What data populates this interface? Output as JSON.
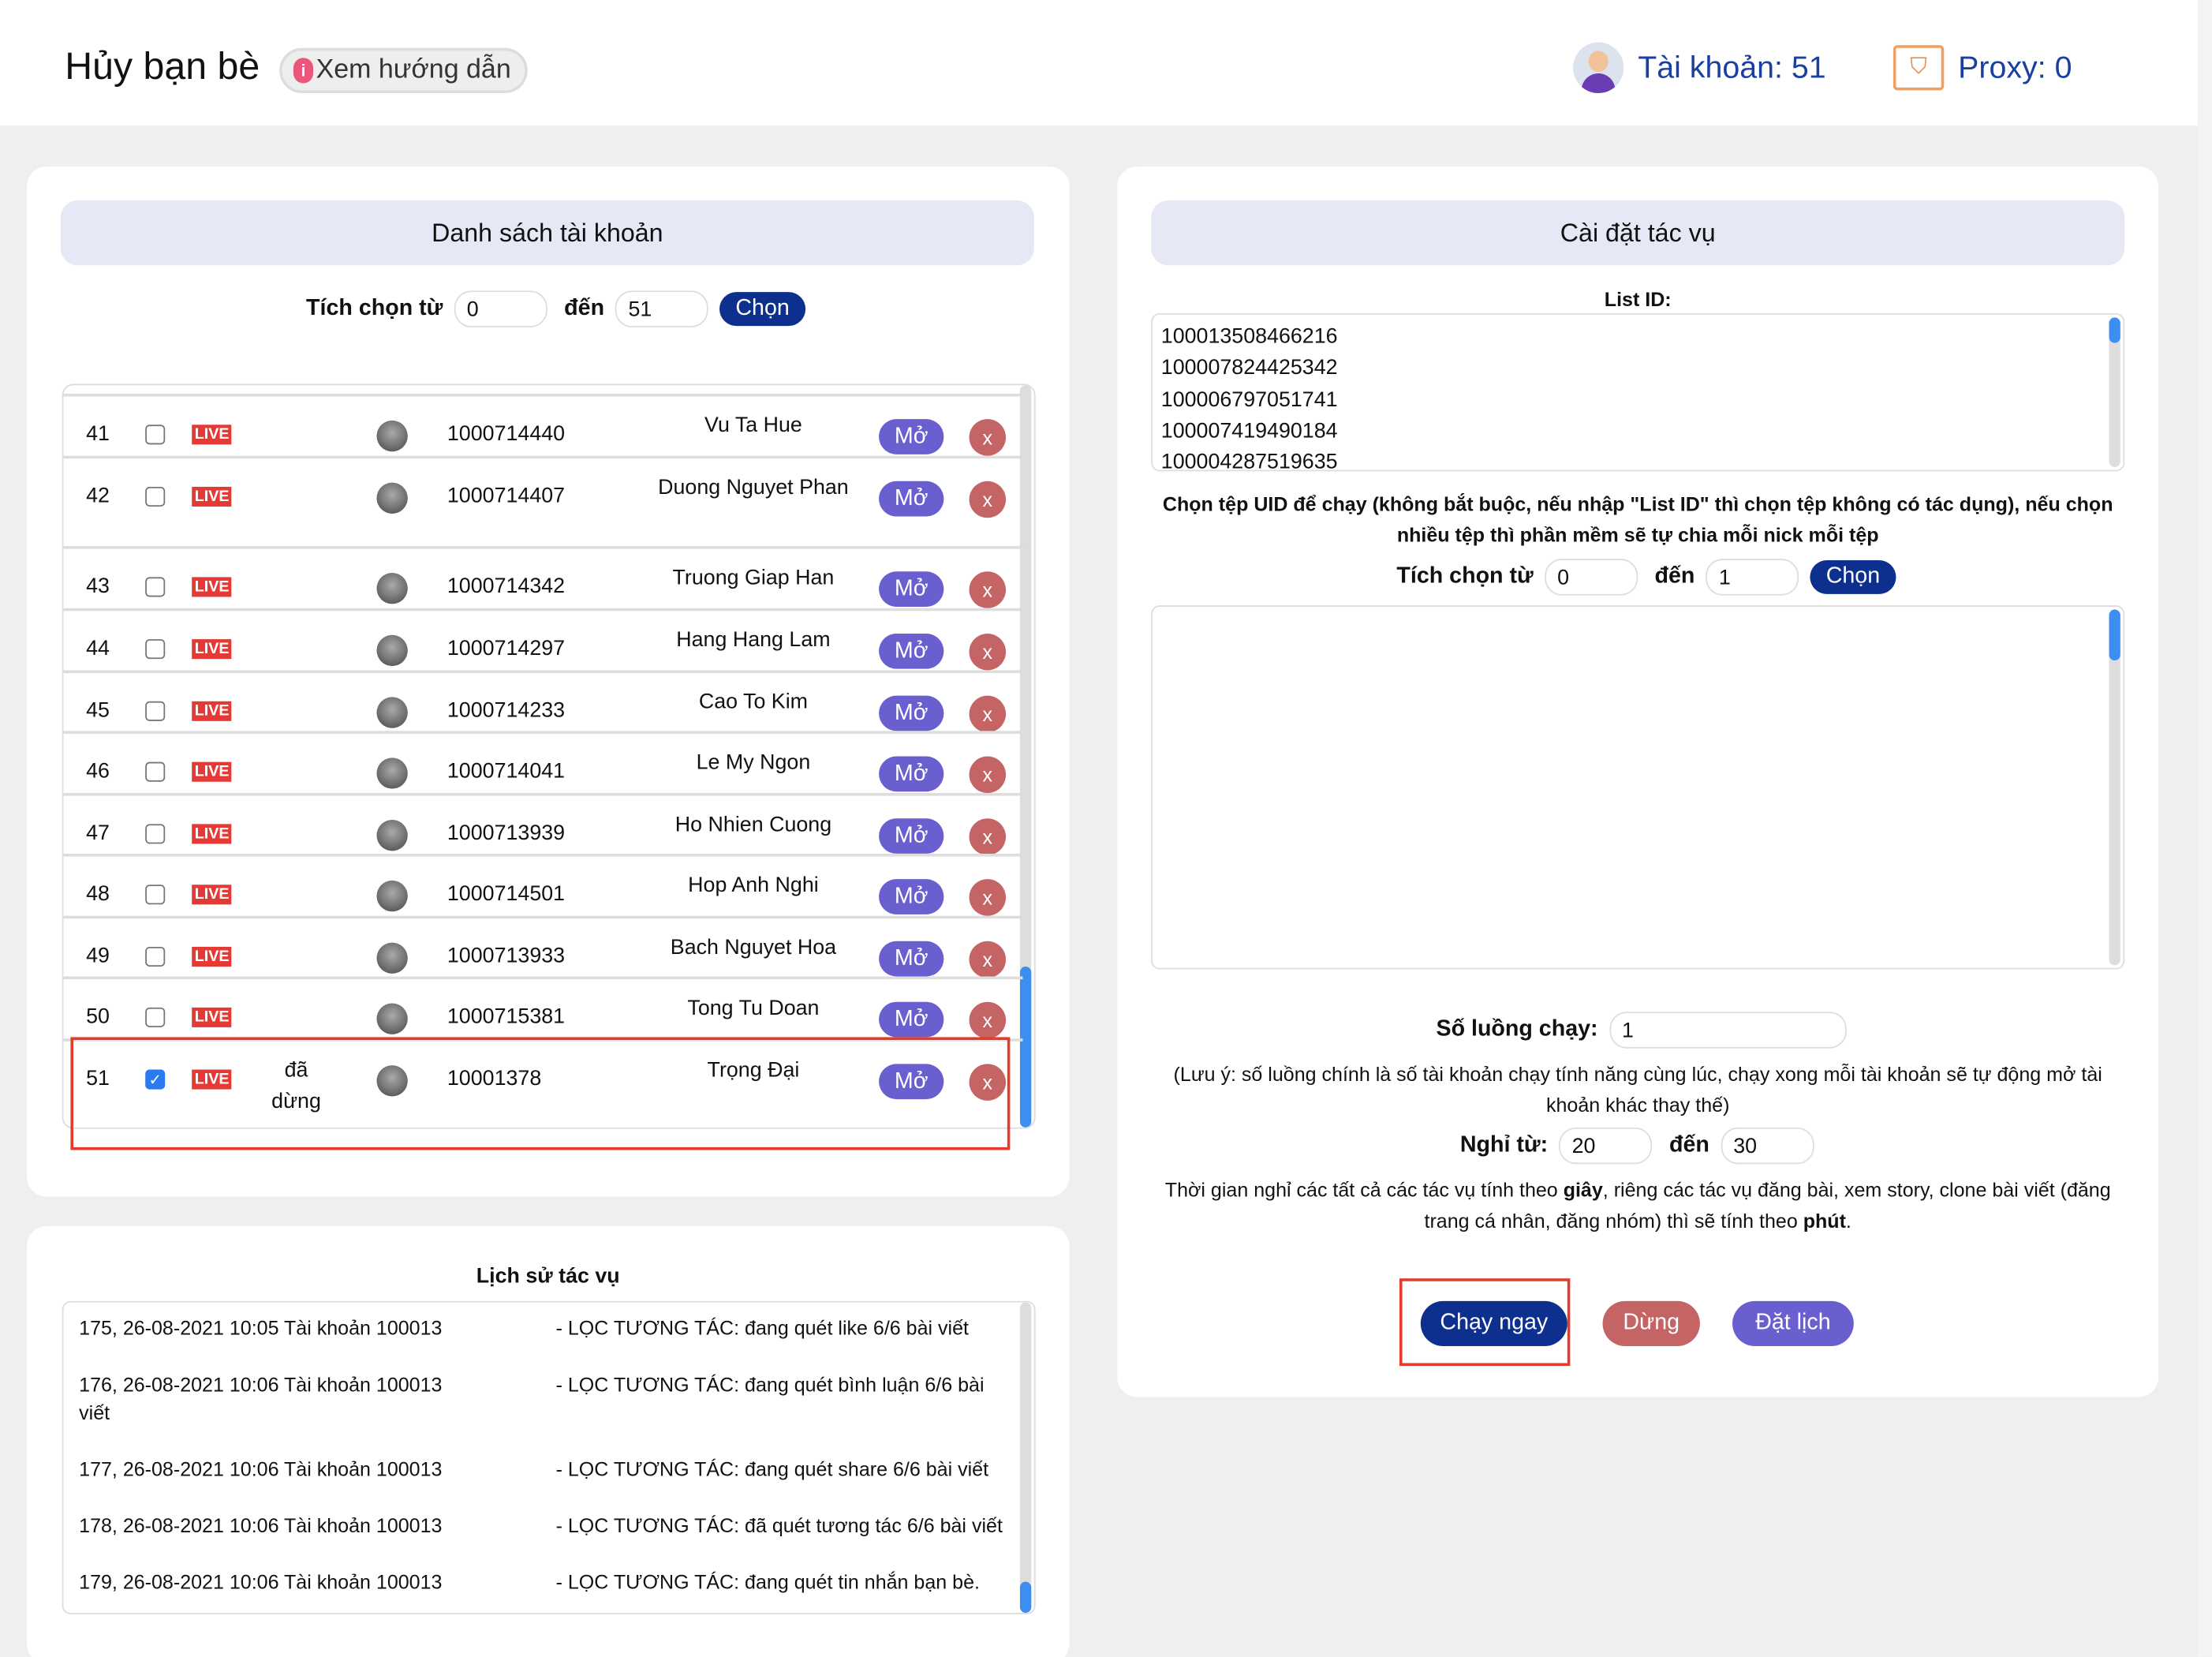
{
  "header": {
    "title": "Hủy bạn bè",
    "guide_label": "Xem hướng dẫn",
    "account_label": "Tài khoản: 51",
    "proxy_label": "Proxy: 0"
  },
  "accounts_panel": {
    "title": "Danh sách tài khoản",
    "range_label": "Tích chọn từ",
    "range_from": "0",
    "range_to_label": "đến",
    "range_to": "51",
    "choose_label": "Chọn",
    "rows": [
      {
        "no": "41",
        "checked": false,
        "status": "LIVE",
        "state": "",
        "uid": "1000714440",
        "name": "Vu Ta Hue"
      },
      {
        "no": "42",
        "checked": false,
        "status": "LIVE",
        "state": "",
        "uid": "1000714407",
        "name": "Duong Nguyet Phan"
      },
      {
        "no": "43",
        "checked": false,
        "status": "LIVE",
        "state": "",
        "uid": "1000714342",
        "name": "Truong Giap Han"
      },
      {
        "no": "44",
        "checked": false,
        "status": "LIVE",
        "state": "",
        "uid": "1000714297",
        "name": "Hang Hang Lam"
      },
      {
        "no": "45",
        "checked": false,
        "status": "LIVE",
        "state": "",
        "uid": "1000714233",
        "name": "Cao To Kim"
      },
      {
        "no": "46",
        "checked": false,
        "status": "LIVE",
        "state": "",
        "uid": "1000714041",
        "name": "Le My Ngon"
      },
      {
        "no": "47",
        "checked": false,
        "status": "LIVE",
        "state": "",
        "uid": "1000713939",
        "name": "Ho Nhien Cuong"
      },
      {
        "no": "48",
        "checked": false,
        "status": "LIVE",
        "state": "",
        "uid": "1000714501",
        "name": "Hop Anh Nghi"
      },
      {
        "no": "49",
        "checked": false,
        "status": "LIVE",
        "state": "",
        "uid": "1000713933",
        "name": "Bach Nguyet Hoa"
      },
      {
        "no": "50",
        "checked": false,
        "status": "LIVE",
        "state": "",
        "uid": "1000715381",
        "name": "Tong Tu Doan"
      },
      {
        "no": "51",
        "checked": true,
        "status": "LIVE",
        "state": "đã dừng",
        "uid": "10001378",
        "name": "Trọng Đại"
      }
    ],
    "open_label": "Mở",
    "remove_label": "x"
  },
  "history_panel": {
    "title": "Lịch sử tác vụ",
    "lines": [
      {
        "left": "175, 26-08-2021 10:05 Tài khoản 100013",
        "right": "- LỌC TƯƠNG TÁC: đang quét like 6/6 bài viết"
      },
      {
        "left": "176, 26-08-2021 10:06 Tài khoản 100013",
        "right": "- LỌC TƯƠNG TÁC: đang quét bình luận 6/6 bài viết"
      },
      {
        "left": "177, 26-08-2021 10:06 Tài khoản 100013",
        "right": "- LỌC TƯƠNG TÁC: đang quét share 6/6 bài viết"
      },
      {
        "left": "178, 26-08-2021 10:06 Tài khoản 100013",
        "right": "- LỌC TƯƠNG TÁC: đã quét tương tác 6/6 bài viết"
      },
      {
        "left": "179, 26-08-2021 10:06 Tài khoản 100013",
        "right": "- LỌC TƯƠNG TÁC: đang quét tin nhắn bạn bè."
      }
    ]
  },
  "settings_panel": {
    "title": "Cài đặt tác vụ",
    "list_id_label": "List ID:",
    "list_ids": [
      "100013508466216",
      "100007824425342",
      "100006797051741",
      "100007419490184",
      "100004287519635"
    ],
    "uid_file_note": "Chọn tệp UID để chạy (không bắt buộc, nếu nhập \"List ID\" thì chọn tệp không có tác dụng), nếu chọn nhiều tệp thì phần mềm sẽ tự chia mỗi nick mỗi tệp",
    "range_label": "Tích chọn từ",
    "range_from": "0",
    "range_to_label": "đến",
    "range_to": "1",
    "choose_label": "Chọn",
    "threads_label": "Số luồng chạy:",
    "threads": "1",
    "threads_note": "(Lưu ý: số luồng chính là số tài khoản chạy tính năng cùng lúc, chạy xong mỗi tài khoản sẽ tự động mở tài khoản khác thay thế)",
    "rest_label": "Nghỉ từ:",
    "rest_from": "20",
    "rest_to_label": "đến",
    "rest_to": "30",
    "time_note_1": "Thời gian nghỉ các tất cả các tác vụ tính theo ",
    "time_note_b1": "giây",
    "time_note_2": ", riêng các tác vụ đăng bài, xem story, clone bài viết (đăng trang cá nhân, đăng nhóm) thì sẽ tính theo ",
    "time_note_b2": "phút",
    "time_note_3": ".",
    "run_label": "Chạy ngay",
    "stop_label": "Dừng",
    "schedule_label": "Đặt lịch"
  },
  "colors": {
    "primary": "#0d2f8e",
    "open": "#6a5fcf",
    "remove": "#c46464",
    "live": "#e53935",
    "highlight": "#e53b2c"
  }
}
